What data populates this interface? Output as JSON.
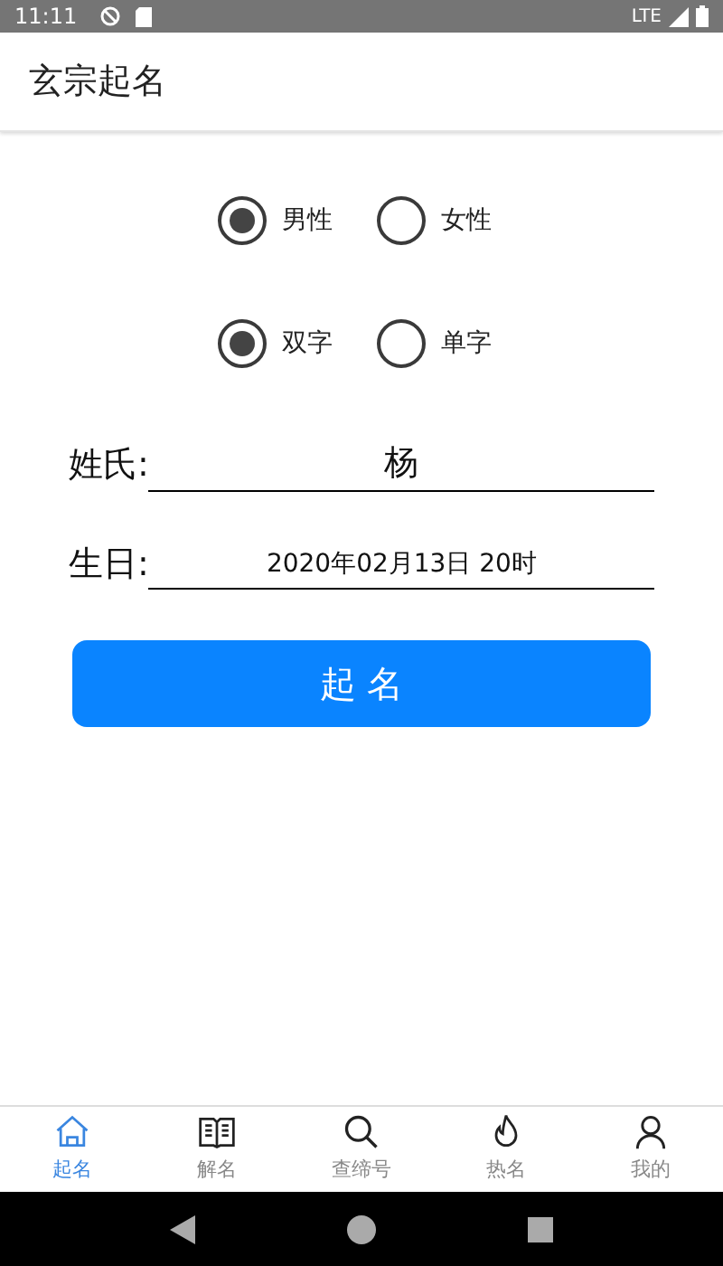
{
  "status_bar": {
    "time": "11:11",
    "network": "LTE"
  },
  "app_bar": {
    "title": "玄宗起名"
  },
  "gender": [
    {
      "label": "男性",
      "selected": true
    },
    {
      "label": "女性",
      "selected": false
    }
  ],
  "name_length": [
    {
      "label": "双字",
      "selected": true
    },
    {
      "label": "单字",
      "selected": false
    }
  ],
  "fields": [
    {
      "label": "姓氏:",
      "value": "杨",
      "kind": "large"
    },
    {
      "label": "生日:",
      "value": "2020年02月13日 20时",
      "kind": "small"
    }
  ],
  "submit_button": "起 名",
  "bottom_nav": [
    {
      "label": "起名",
      "selected": true
    },
    {
      "label": "解名",
      "selected": false
    },
    {
      "label": "查缔号",
      "selected": false
    },
    {
      "label": "热名",
      "selected": false
    },
    {
      "label": "我的",
      "selected": false
    }
  ]
}
